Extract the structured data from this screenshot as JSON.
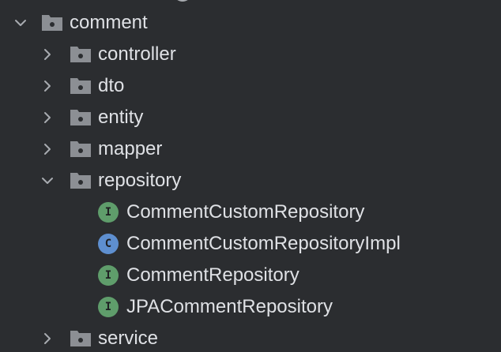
{
  "tree": {
    "items": [
      {
        "label": "comment",
        "kind": "folder",
        "expanded": true
      },
      {
        "label": "controller",
        "kind": "folder",
        "expanded": false
      },
      {
        "label": "dto",
        "kind": "folder",
        "expanded": false
      },
      {
        "label": "entity",
        "kind": "folder",
        "expanded": false
      },
      {
        "label": "mapper",
        "kind": "folder",
        "expanded": false
      },
      {
        "label": "repository",
        "kind": "folder",
        "expanded": true
      },
      {
        "label": "CommentCustomRepository",
        "kind": "interface",
        "badge": "I"
      },
      {
        "label": "CommentCustomRepositoryImpl",
        "kind": "class",
        "badge": "C"
      },
      {
        "label": "CommentRepository",
        "kind": "interface",
        "badge": "I"
      },
      {
        "label": "JPACommentRepository",
        "kind": "interface",
        "badge": "I"
      },
      {
        "label": "service",
        "kind": "folder",
        "expanded": false
      }
    ]
  },
  "colors": {
    "background": "#2b2d30",
    "text": "#dfe1e5",
    "folder_icon": "#8c8f94",
    "chevron": "#a8abb0",
    "interface_badge": "#5f9d6b",
    "class_badge": "#5e8fd0"
  }
}
